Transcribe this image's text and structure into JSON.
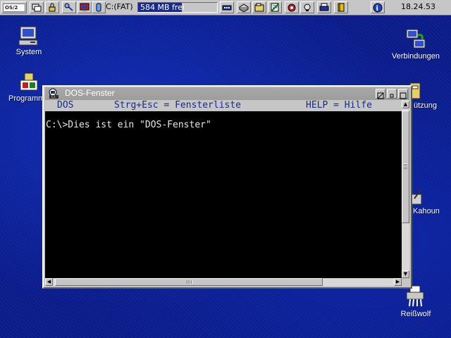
{
  "taskbar": {
    "logo_text": "OS/2",
    "drive_label": "C:(FAT)",
    "drive_free": "584 MB frei",
    "drive_fill_fraction": 0.55,
    "clock": "18.24.53",
    "icons": [
      "window-list-icon",
      "lock-icon",
      "find-icon",
      "monitor-icon",
      "disk-icon",
      "drive-icon",
      "folder-icon",
      "notepad-icon",
      "tools-icon",
      "process-icon",
      "printer-icon",
      "book-icon",
      "help-icon"
    ]
  },
  "desktop": {
    "icons": {
      "system": "System",
      "programs": "Programm",
      "connections": "Verbindungen",
      "shortcuts": "ützung",
      "kahoun": "Kahoun",
      "shredder": "Reißwolf"
    }
  },
  "dos_window": {
    "title": "DOS-Fenster",
    "menu_left": "DOS",
    "menu_center": "Strg+Esc = Fensterliste",
    "menu_right": "HELP = Hilfe",
    "console_line": "C:\\>Dies ist ein \"DOS-Fenster\""
  },
  "colors": {
    "desktop": "#0b1d8c",
    "titlebar_inactive": "#a0a0a0",
    "menu_text": "#1a2a8a",
    "console_bg": "#000000"
  }
}
